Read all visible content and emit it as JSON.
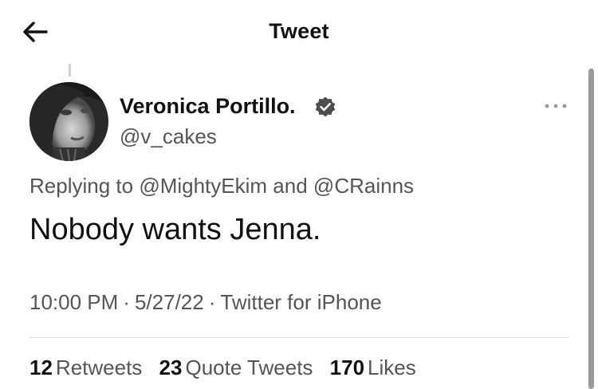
{
  "header": {
    "title": "Tweet",
    "back_icon": "arrow-left-icon"
  },
  "tweet": {
    "author": {
      "display_name": "Veronica Portillo.",
      "handle": "@v_cakes",
      "verified_icon": "verified-badge-icon"
    },
    "reply": {
      "prefix": "Replying to",
      "mention_1": "@MightyEkim",
      "conjunction": "and",
      "mention_2": "@CRainns"
    },
    "text": "Nobody wants Jenna.",
    "time": "10:00 PM",
    "date": "5/27/22",
    "separator": "·",
    "source": "Twitter for iPhone",
    "more_icon": "more-horizontal-icon"
  },
  "stats": {
    "retweets_count": "12",
    "retweets_label": "Retweets",
    "quotes_count": "23",
    "quotes_label": "Quote Tweets",
    "likes_count": "170",
    "likes_label": "Likes"
  },
  "colors": {
    "text_primary": "#111111",
    "text_secondary": "#555555",
    "divider": "#dcdcdc",
    "background": "#ffffff"
  }
}
